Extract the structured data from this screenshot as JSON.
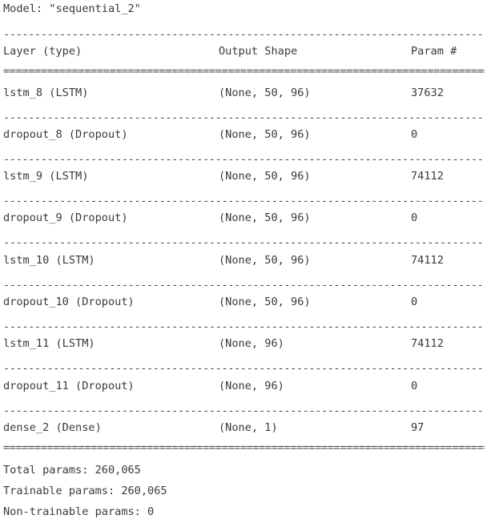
{
  "model_line": "Model: \"sequential_2\"",
  "separators": {
    "dash": "---------------------------------------------------------------------------------------------------------",
    "equal": "========================================================================================================="
  },
  "header": {
    "layer": "Layer (type)",
    "output_shape": "Output Shape",
    "params": "Param #"
  },
  "rows": [
    {
      "layer": "lstm_8 (LSTM)",
      "shape": "(None, 50, 96)",
      "params": "37632"
    },
    {
      "layer": "dropout_8 (Dropout)",
      "shape": "(None, 50, 96)",
      "params": "0"
    },
    {
      "layer": "lstm_9 (LSTM)",
      "shape": "(None, 50, 96)",
      "params": "74112"
    },
    {
      "layer": "dropout_9 (Dropout)",
      "shape": "(None, 50, 96)",
      "params": "0"
    },
    {
      "layer": "lstm_10 (LSTM)",
      "shape": "(None, 50, 96)",
      "params": "74112"
    },
    {
      "layer": "dropout_10 (Dropout)",
      "shape": "(None, 50, 96)",
      "params": "0"
    },
    {
      "layer": "lstm_11 (LSTM)",
      "shape": "(None, 96)",
      "params": "74112"
    },
    {
      "layer": "dropout_11 (Dropout)",
      "shape": "(None, 96)",
      "params": "0"
    },
    {
      "layer": "dense_2 (Dense)",
      "shape": "(None, 1)",
      "params": "97"
    }
  ],
  "summary": {
    "total": "Total params: 260,065",
    "trainable": "Trainable params: 260,065",
    "non_trainable": "Non-trainable params: 0"
  }
}
